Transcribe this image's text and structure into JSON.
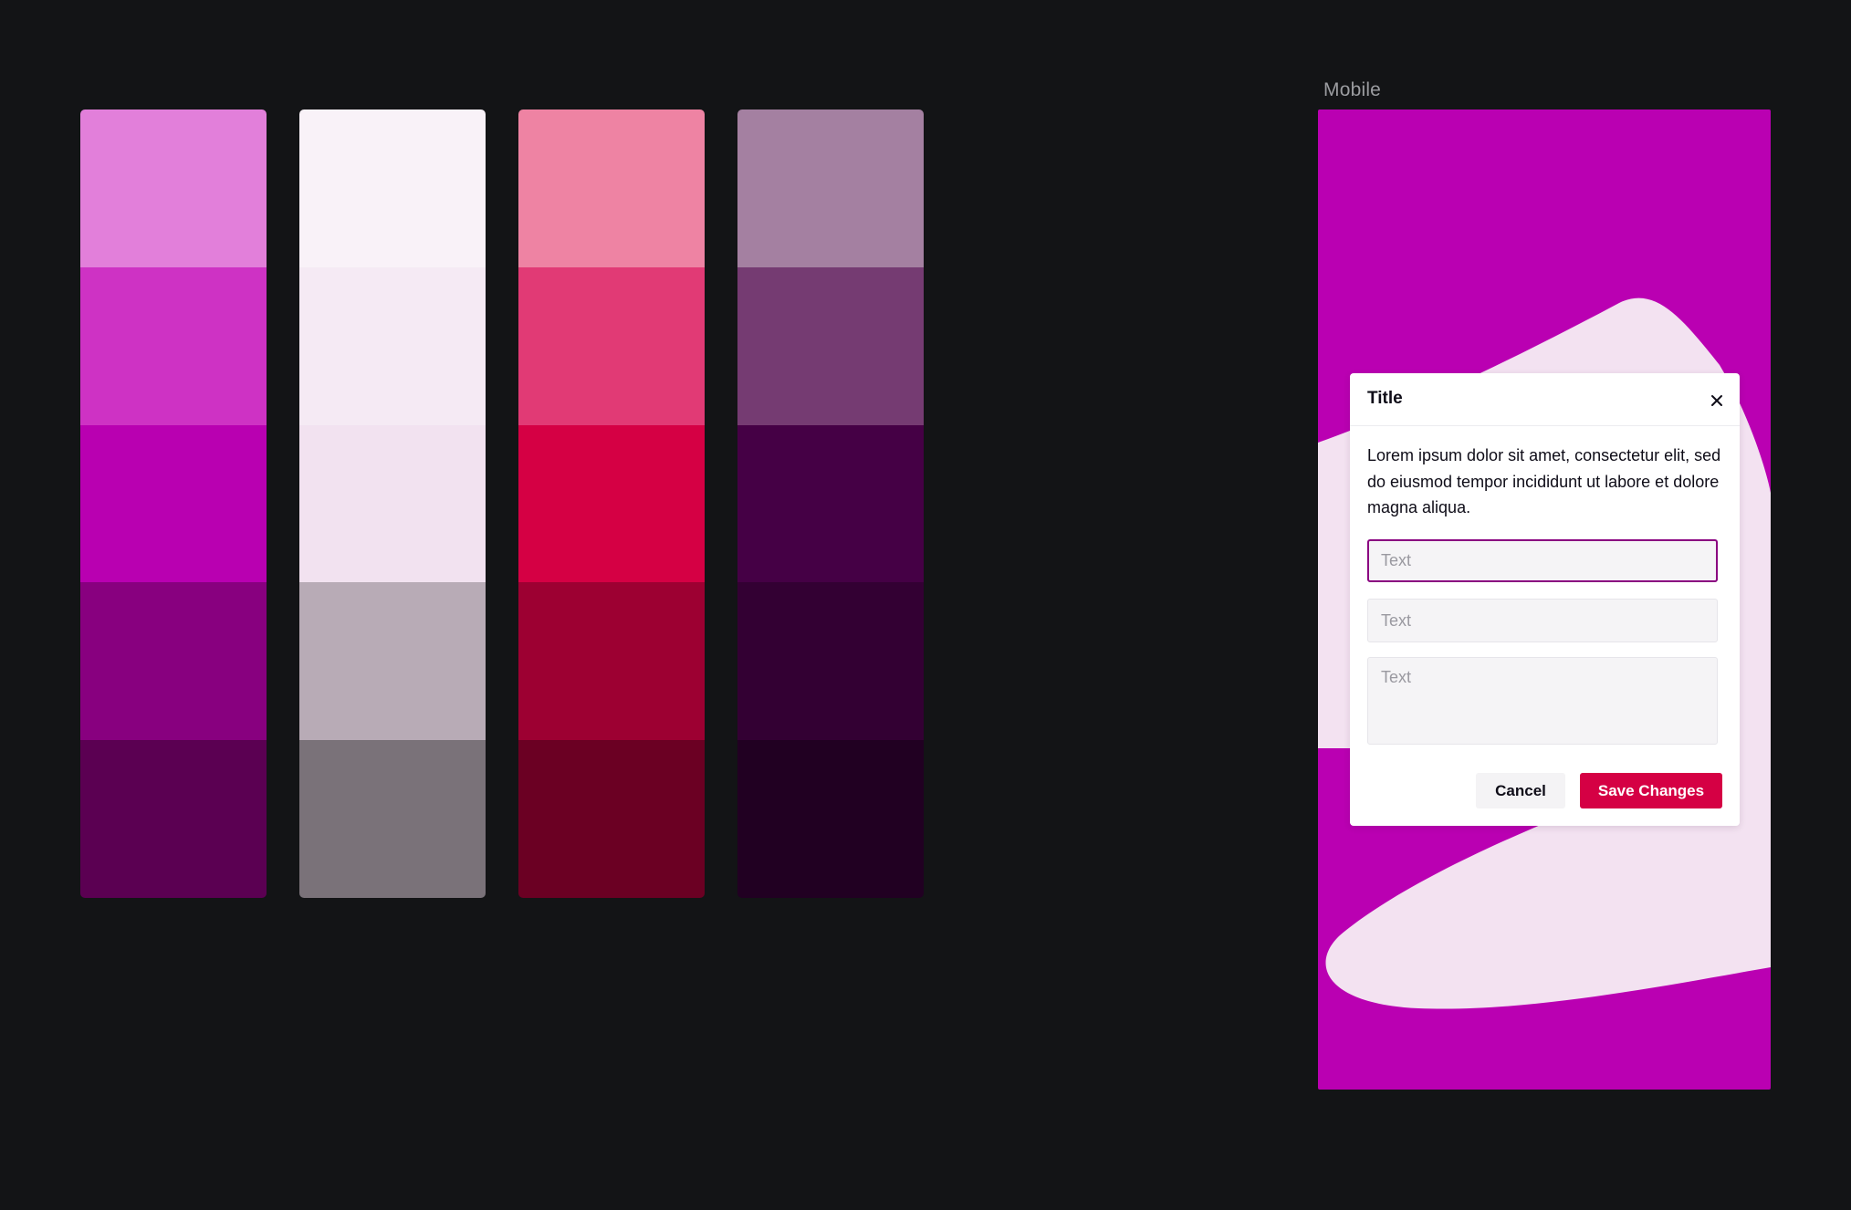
{
  "palette": {
    "columns": [
      {
        "swatches": [
          "#e27fda",
          "#ce32c4",
          "#b900b1",
          "#88007f",
          "#5b0052"
        ]
      },
      {
        "swatches": [
          "#f9f2f8",
          "#f5eaf4",
          "#f2e2f0",
          "#b8abb6",
          "#7a7279"
        ]
      },
      {
        "swatches": [
          "#ee83a3",
          "#e13a75",
          "#d50044",
          "#9d0032",
          "#6b0023"
        ]
      },
      {
        "swatches": [
          "#a480a1",
          "#753b72",
          "#450045",
          "#330033",
          "#210022"
        ]
      }
    ]
  },
  "frame": {
    "label": "Mobile",
    "background_color": "#ba00b2",
    "blob_color": "#f3e2f1"
  },
  "modal": {
    "title": "Title",
    "close_icon": "close-icon",
    "body": "Lorem ipsum dolor sit amet, consectetur elit, sed do eiusmod tempor incididunt ut labore et dolore magna aliqua.",
    "fields": [
      {
        "placeholder": "Text",
        "value": "",
        "focused": true
      },
      {
        "placeholder": "Text",
        "value": ""
      },
      {
        "placeholder": "Text",
        "value": "",
        "multiline": true
      }
    ],
    "cancel_label": "Cancel",
    "save_label": "Save Changes",
    "accent_color": "#d50044",
    "focus_color": "#8a0080"
  }
}
